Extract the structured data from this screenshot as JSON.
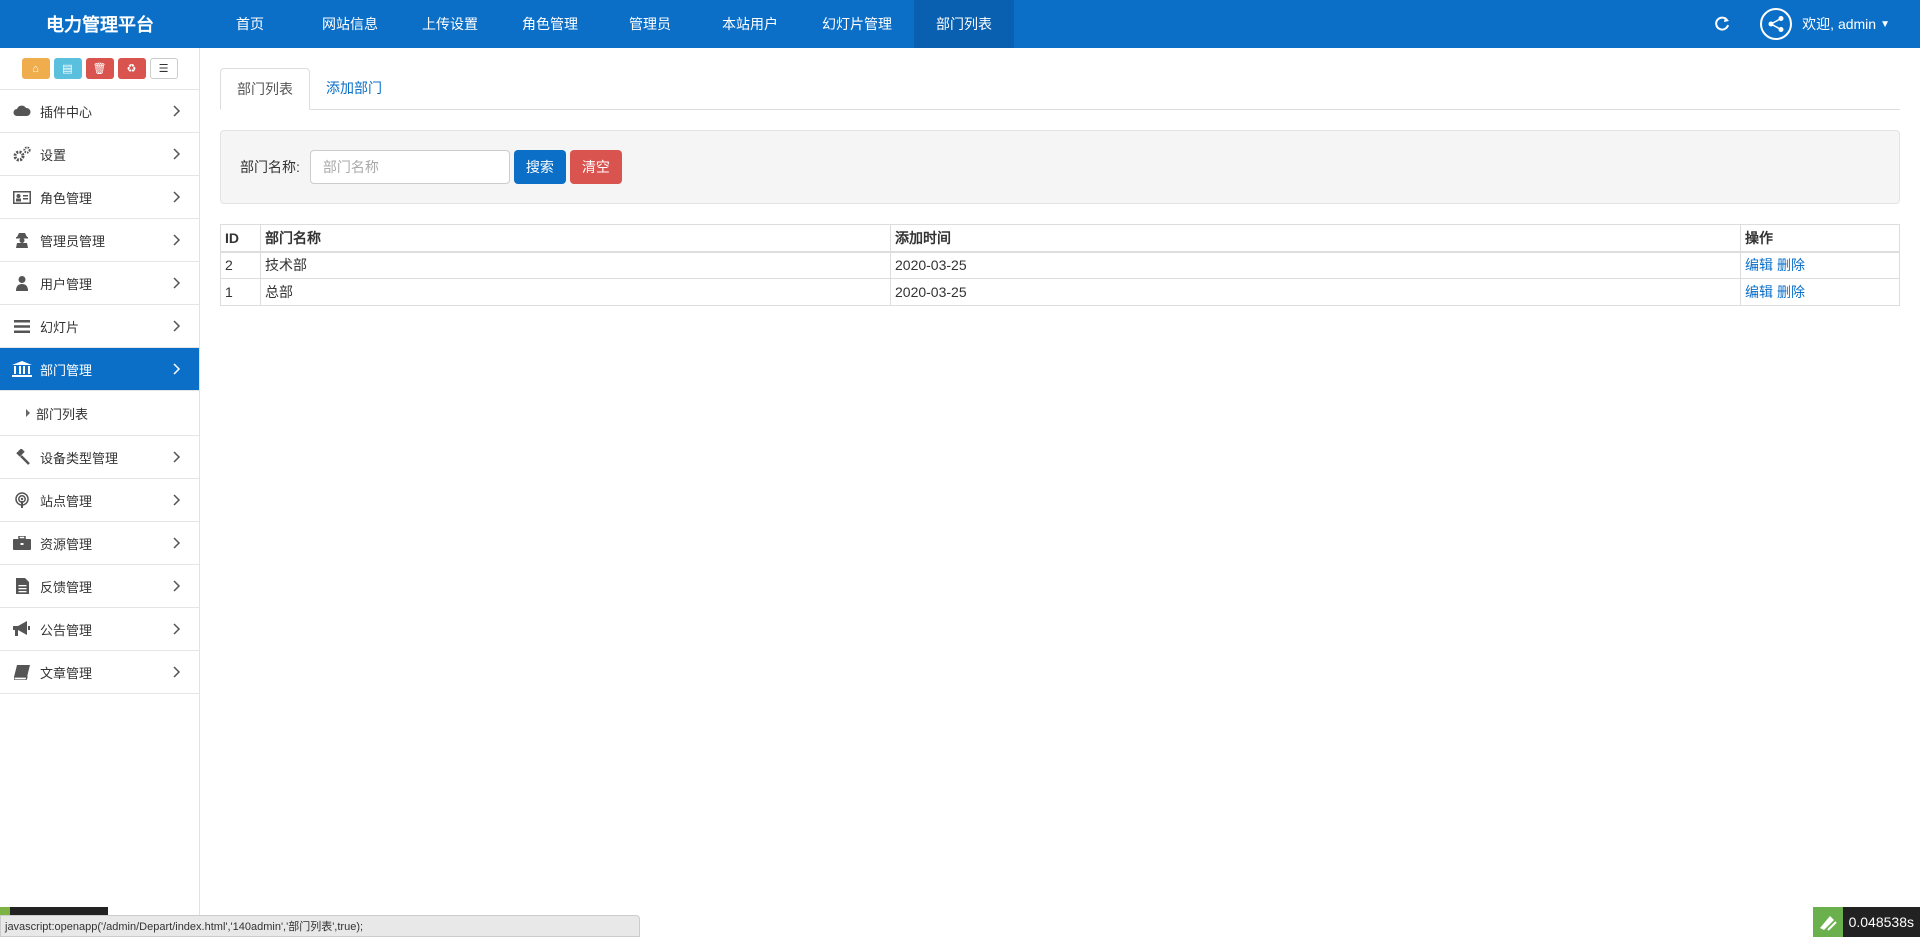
{
  "app": {
    "brand": "电力管理平台"
  },
  "topnav": {
    "items": [
      {
        "label": "首页"
      },
      {
        "label": "网站信息"
      },
      {
        "label": "上传设置"
      },
      {
        "label": "角色管理"
      },
      {
        "label": "管理员"
      },
      {
        "label": "本站用户"
      },
      {
        "label": "幻灯片管理"
      },
      {
        "label": "部门列表"
      }
    ],
    "active_index": 7,
    "welcome": "欢迎, admin"
  },
  "sidebar": {
    "shortcuts": [
      "home-icon",
      "file-icon",
      "trash-icon",
      "recycle-icon",
      "list-icon"
    ],
    "items": [
      {
        "label": "插件中心",
        "icon": "cloud-icon"
      },
      {
        "label": "设置",
        "icon": "gears-icon"
      },
      {
        "label": "角色管理",
        "icon": "id-card-icon"
      },
      {
        "label": "管理员管理",
        "icon": "user-secret-icon"
      },
      {
        "label": "用户管理",
        "icon": "user-icon"
      },
      {
        "label": "幻灯片",
        "icon": "bars-icon"
      },
      {
        "label": "部门管理",
        "icon": "bank-icon",
        "active": true
      },
      {
        "label": "设备类型管理",
        "icon": "gavel-icon"
      },
      {
        "label": "站点管理",
        "icon": "podcast-icon"
      },
      {
        "label": "资源管理",
        "icon": "briefcase-icon"
      },
      {
        "label": "反馈管理",
        "icon": "file-text-icon"
      },
      {
        "label": "公告管理",
        "icon": "bullhorn-icon"
      },
      {
        "label": "文章管理",
        "icon": "book-icon"
      }
    ],
    "submenu": {
      "label": "部门列表"
    }
  },
  "tabs": [
    {
      "label": "部门列表",
      "active": true
    },
    {
      "label": "添加部门",
      "active": false
    }
  ],
  "search": {
    "label": "部门名称:",
    "placeholder": "部门名称",
    "value": "",
    "search_button": "搜索",
    "clear_button": "清空"
  },
  "table": {
    "headers": [
      "ID",
      "部门名称",
      "添加时间",
      "操作"
    ],
    "rows": [
      {
        "id": "2",
        "name": "技术部",
        "added": "2020-03-25",
        "edit": "编辑",
        "delete": "删除"
      },
      {
        "id": "1",
        "name": "总部",
        "added": "2020-03-25",
        "edit": "编辑",
        "delete": "删除"
      }
    ]
  },
  "statusbar": {
    "text": "javascript:openapp('/admin/Depart/index.html','140admin','部门列表',true);"
  },
  "timer": {
    "text": "0.048538s"
  },
  "colors": {
    "primary": "#0b6fc8",
    "danger": "#d9534f",
    "warning": "#f0ad4e",
    "info": "#5bc0de"
  }
}
